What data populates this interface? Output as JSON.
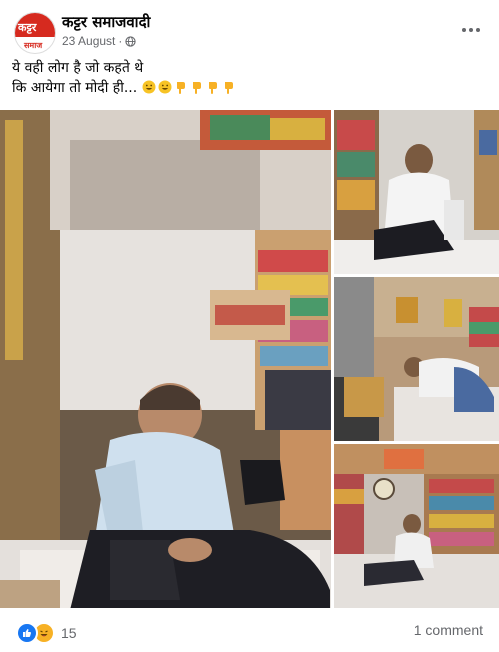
{
  "post": {
    "page_name": "कट्टर समाजवादी",
    "avatar_logo_text": "कट्टर",
    "avatar_sub_text": "समाज",
    "date": "23 August",
    "separator": "·",
    "caption_line1": "ये वही लोग है जो कहते थे",
    "caption_line2": "कि आयेगा तो मोदी ही...",
    "caption_emojis": [
      "grinning-face",
      "grinning-face",
      "backhand-index-pointing-down",
      "backhand-index-pointing-down",
      "backhand-index-pointing-down",
      "backhand-index-pointing-down"
    ]
  },
  "photos": [
    {
      "id": "photo-main",
      "description": "man sleeping in sari shop"
    },
    {
      "id": "photo-top-right",
      "description": "man sleeping against wall"
    },
    {
      "id": "photo-mid-right",
      "description": "man lying on shop floor"
    },
    {
      "id": "photo-bottom-right",
      "description": "man reclining near wall clock"
    }
  ],
  "footer": {
    "reaction_count": "15",
    "comments_label": "1 comment",
    "reaction_icons": [
      "like-icon",
      "haha-icon"
    ]
  },
  "colors": {
    "brand_red": "#d62a1f",
    "like_blue": "#1877f2",
    "haha_yellow": "#f7b125",
    "meta_gray": "#65676b"
  }
}
